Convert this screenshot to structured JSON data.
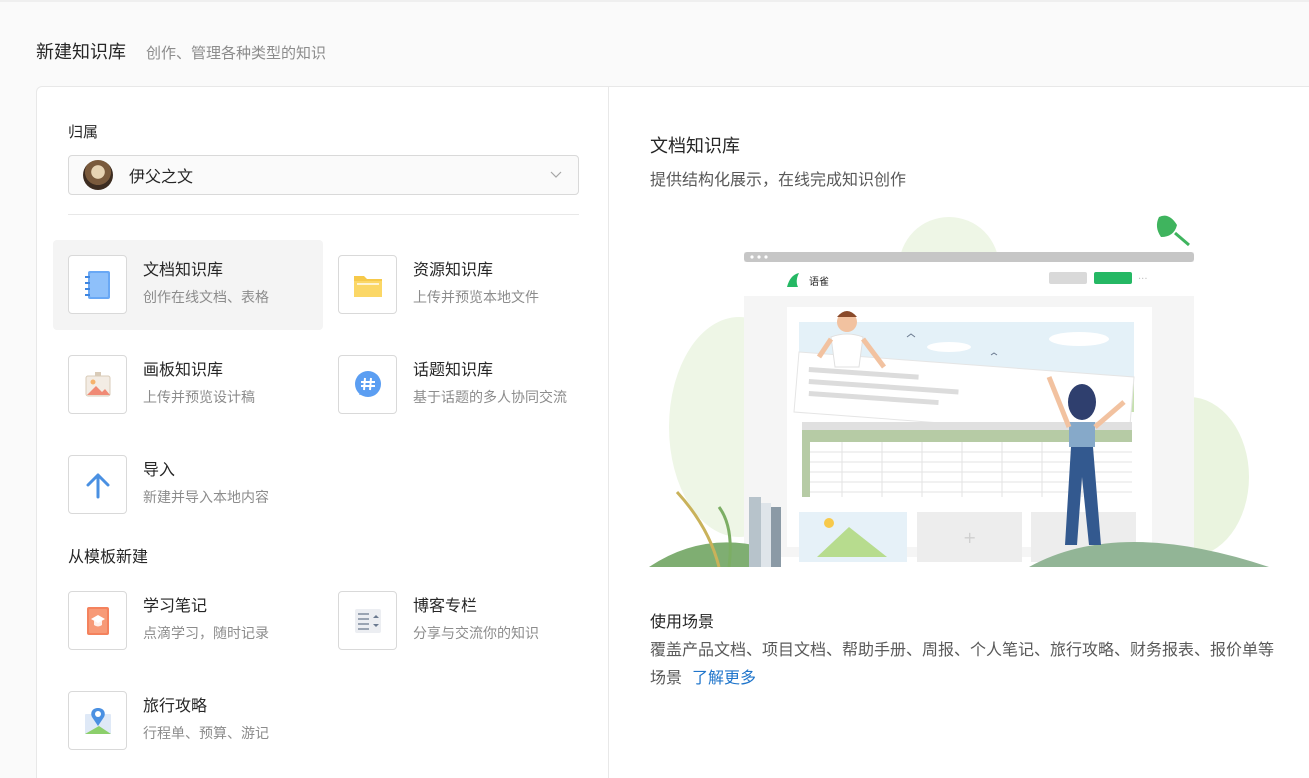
{
  "header": {
    "title": "新建知识库",
    "subtitle": "创作、管理各种类型的知识"
  },
  "owner": {
    "label": "归属",
    "name": "伊父之文"
  },
  "types": [
    {
      "title": "文档知识库",
      "desc": "创作在线文档、表格",
      "icon": "doc-notebook-icon"
    },
    {
      "title": "资源知识库",
      "desc": "上传并预览本地文件",
      "icon": "folder-icon"
    },
    {
      "title": "画板知识库",
      "desc": "上传并预览设计稿",
      "icon": "picture-board-icon"
    },
    {
      "title": "话题知识库",
      "desc": "基于话题的多人协同交流",
      "icon": "hashtag-bubble-icon"
    },
    {
      "title": "导入",
      "desc": "新建并导入本地内容",
      "icon": "arrow-up-icon"
    }
  ],
  "templates_label": "从模板新建",
  "templates": [
    {
      "title": "学习笔记",
      "desc": "点滴学习，随时记录",
      "icon": "study-book-icon"
    },
    {
      "title": "博客专栏",
      "desc": "分享与交流你的知识",
      "icon": "blog-list-icon"
    },
    {
      "title": "旅行攻略",
      "desc": "行程单、预算、游记",
      "icon": "map-pin-icon"
    }
  ],
  "detail": {
    "title": "文档知识库",
    "desc": "提供结构化展示，在线完成知识创作",
    "illustration_brand": "语雀",
    "scene_title": "使用场景",
    "scene_desc": "覆盖产品文档、项目文档、帮助手册、周报、个人笔记、旅行攻略、财务报表、报价单等场景",
    "learn_more": "了解更多"
  },
  "colors": {
    "link": "#1f75cb",
    "brand_green": "#25b864"
  }
}
